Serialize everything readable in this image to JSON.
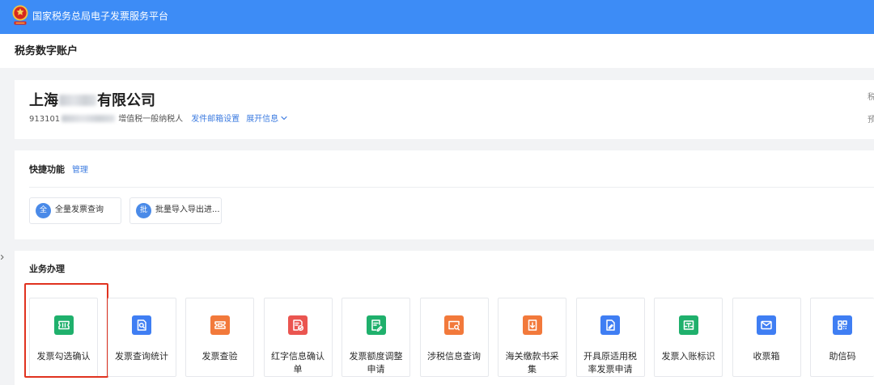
{
  "header": {
    "title": "国家税务总局电子发票服务平台",
    "logo_icon": "tax-emblem-icon"
  },
  "account": {
    "title": "税务数字账户"
  },
  "company": {
    "name_prefix": "上海",
    "name_suffix": "有限公司",
    "tax_id_prefix": "913101",
    "taxpayer_type": "增值税一般纳税人",
    "email_settings_link": "发件邮箱设置",
    "expand_info_link": "展开信息",
    "right_labels": [
      "税",
      "预"
    ]
  },
  "quick_functions": {
    "title": "快捷功能",
    "manage_link": "管理",
    "items": [
      {
        "icon_text": "全",
        "label": "全量发票查询"
      },
      {
        "icon_text": "批",
        "label": "批量导入导出进..."
      }
    ]
  },
  "business": {
    "title": "业务办理",
    "highlighted_index": 0,
    "tiles": [
      {
        "label": "发票勾选确认",
        "icon": "ticket-icon",
        "color": "#1fb06c"
      },
      {
        "label": "发票查询统计",
        "icon": "document-search-icon",
        "color": "#3f7ef3"
      },
      {
        "label": "发票查验",
        "icon": "ticket-verify-icon",
        "color": "#f2793b"
      },
      {
        "label": "红字信息确认单",
        "icon": "document-check-icon",
        "color": "#ea5550"
      },
      {
        "label": "发票额度调整申请",
        "icon": "document-edit-icon",
        "color": "#1fb06c"
      },
      {
        "label": "涉税信息查询",
        "icon": "folder-search-icon",
        "color": "#f2793b"
      },
      {
        "label": "海关缴款书采集",
        "icon": "document-download-icon",
        "color": "#f2793b"
      },
      {
        "label": "开具原适用税率发票申请",
        "icon": "document-pen-icon",
        "color": "#3f7ef3"
      },
      {
        "label": "发票入账标识",
        "icon": "accounting-tray-icon",
        "color": "#1fb06c"
      },
      {
        "label": "收票箱",
        "icon": "envelope-icon",
        "color": "#3f7ef3"
      },
      {
        "label": "助信码",
        "icon": "qr-code-icon",
        "color": "#3f7ef3"
      }
    ]
  },
  "colors": {
    "header": "#3d8cf6",
    "link": "#3e7ce0",
    "quick_icon": "#4a8ae8",
    "highlight": "#e0321f",
    "page_background": "#f2f3f5"
  }
}
